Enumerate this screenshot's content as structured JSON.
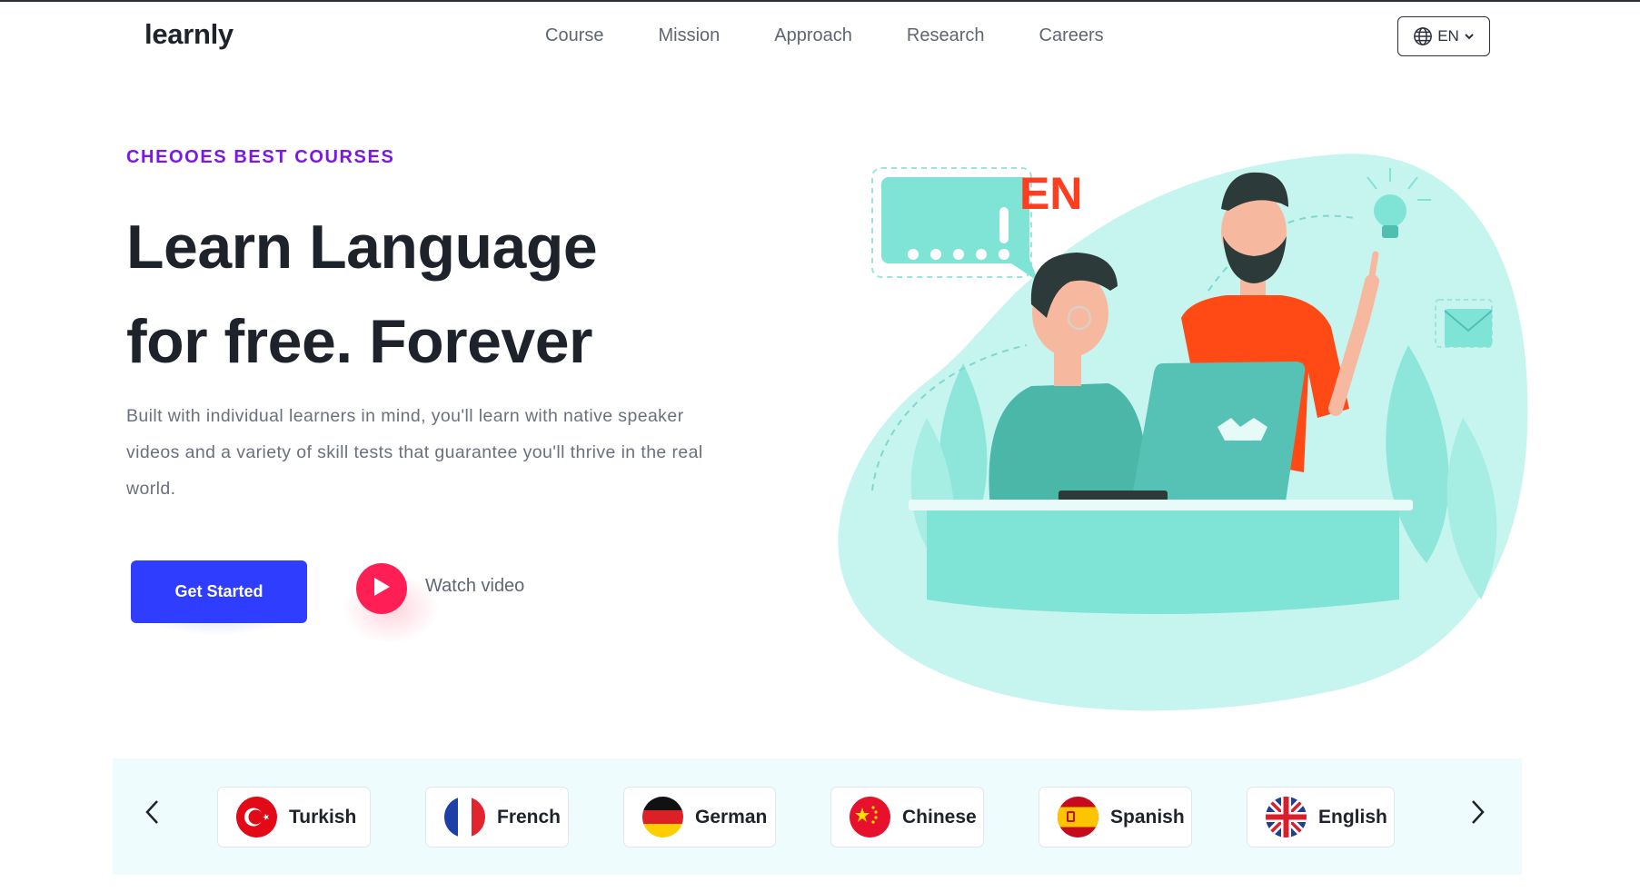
{
  "header": {
    "logo": "learnly",
    "nav": [
      "Course",
      "Mission",
      "Approach",
      "Research",
      "Careers"
    ],
    "language_selector": {
      "value": "EN",
      "icon": "globe-icon"
    }
  },
  "hero": {
    "eyebrow": "CHEOOES BEST COURSES",
    "title_line1": "Learn Language",
    "title_line2": "for free. Forever",
    "description": "Built with individual learners in mind, you'll learn with native speaker videos and a variety of skill tests that guarantee you'll thrive in the real world.",
    "cta_label": "Get Started",
    "watch_label": "Watch video",
    "illustration_badge": "EN"
  },
  "languages": {
    "items": [
      {
        "name": "Turkish",
        "flag": "turkey-flag-icon"
      },
      {
        "name": "French",
        "flag": "france-flag-icon"
      },
      {
        "name": "German",
        "flag": "germany-flag-icon"
      },
      {
        "name": "Chinese",
        "flag": "china-flag-icon"
      },
      {
        "name": "Spanish",
        "flag": "spain-flag-icon"
      },
      {
        "name": "English",
        "flag": "uk-flag-icon"
      }
    ]
  },
  "colors": {
    "accent_purple": "#7b17e8",
    "primary_blue": "#2f3dff",
    "play_red": "#ff1f55",
    "illustration_teal": "#7fe3d6",
    "strip_bg": "#eefcfd"
  }
}
